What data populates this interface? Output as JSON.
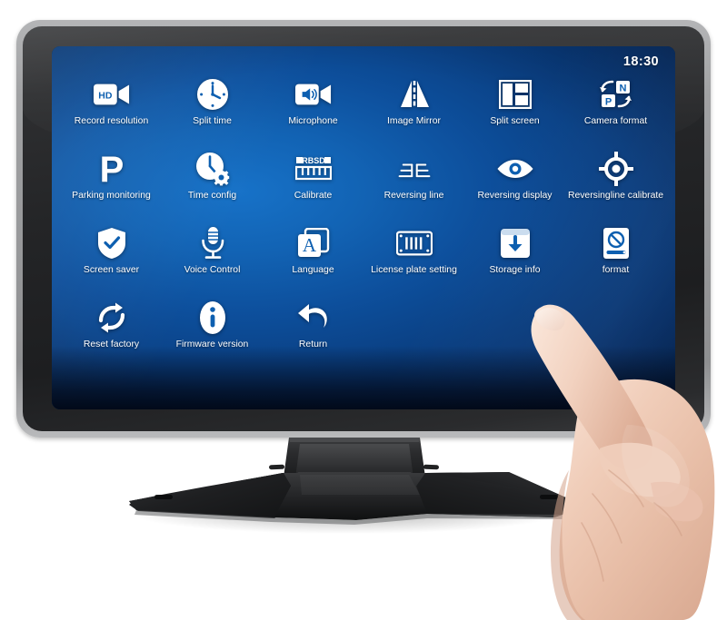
{
  "device": {
    "name": "car-monitor",
    "bezel_color": "#9b9c9e",
    "body_color": "#26272a",
    "screen_accent": "#0d5fb0"
  },
  "screen": {
    "status_bar": {
      "time": "18:30"
    },
    "menu": {
      "columns": 6,
      "items": [
        {
          "label": "Record resolution",
          "icon": "hd-camera-icon"
        },
        {
          "label": "Split time",
          "icon": "clock-icon"
        },
        {
          "label": "Microphone",
          "icon": "speaker-camera-icon"
        },
        {
          "label": "Image Mirror",
          "icon": "mirror-icon"
        },
        {
          "label": "Split screen",
          "icon": "split-screen-icon"
        },
        {
          "label": "Camera format",
          "icon": "ntsc-pal-icon"
        },
        {
          "label": "Parking monitoring",
          "icon": "parking-p-icon"
        },
        {
          "label": "Time config",
          "icon": "clock-gear-icon"
        },
        {
          "label": "Calibrate",
          "icon": "rbsd-ruler-icon"
        },
        {
          "label": "Reversing line",
          "icon": "guide-lines-icon"
        },
        {
          "label": "Reversing display",
          "icon": "eye-icon"
        },
        {
          "label": "Reversingline calibrate",
          "icon": "crosshair-icon"
        },
        {
          "label": "Screen saver",
          "icon": "shield-check-icon"
        },
        {
          "label": "Voice Control",
          "icon": "microphone-icon"
        },
        {
          "label": "Language",
          "icon": "language-a-icon"
        },
        {
          "label": "License plate setting",
          "icon": "license-plate-icon"
        },
        {
          "label": "Storage info",
          "icon": "storage-download-icon"
        },
        {
          "label": "format",
          "icon": "format-disk-icon"
        },
        {
          "label": "Reset factory",
          "icon": "refresh-icon"
        },
        {
          "label": "Firmware version",
          "icon": "info-icon"
        },
        {
          "label": "Return",
          "icon": "back-arrow-icon"
        }
      ]
    }
  }
}
